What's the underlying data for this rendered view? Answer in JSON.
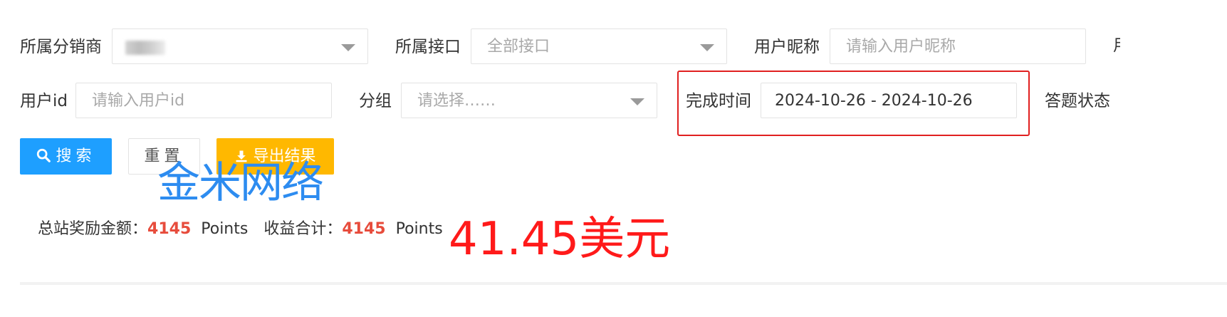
{
  "filters": {
    "distributor": {
      "label": "所属分销商",
      "value": ""
    },
    "interface": {
      "label": "所属接口",
      "placeholder": "全部接口"
    },
    "nickname": {
      "label": "用户昵称",
      "placeholder": "请输入用户昵称"
    },
    "overflow_label_char": "用",
    "user_id": {
      "label": "用户id",
      "placeholder": "请输入用户id"
    },
    "group": {
      "label": "分组",
      "placeholder": "请选择……"
    },
    "finish_time": {
      "label": "完成时间",
      "value": "2024-10-26 - 2024-10-26"
    },
    "answer_status": {
      "label": "答题状态"
    }
  },
  "buttons": {
    "search": "搜索",
    "reset": "重置",
    "export": "导出结果"
  },
  "watermark": "金米网络",
  "stats": {
    "total_reward_label": "总站奖励金额：",
    "total_reward_value": "4145",
    "total_reward_unit": "Points",
    "income_label": "收益合计：",
    "income_value": "4145",
    "income_unit": "Points"
  },
  "annotation": "41.45美元",
  "colors": {
    "primary": "#1e9fff",
    "warm": "#ffb800",
    "highlight_border": "#e02020",
    "number_red": "#e74c3c",
    "annotation_red": "#ff1a1a",
    "watermark_blue": "#2d8cf0"
  }
}
